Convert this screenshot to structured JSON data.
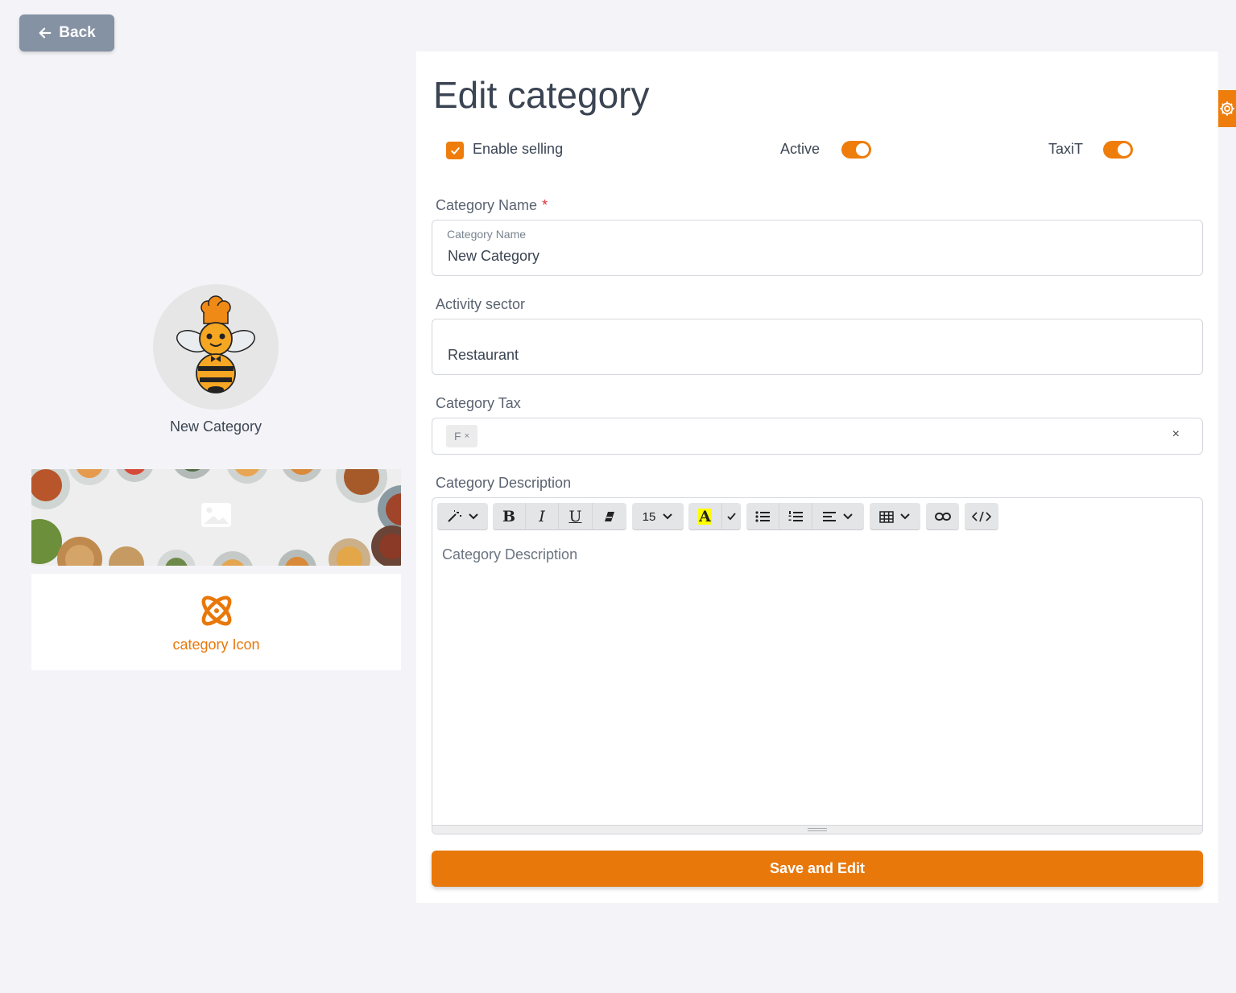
{
  "back": {
    "label": "Back",
    "icon": "arrow-left-icon"
  },
  "preview": {
    "name": "New Category",
    "icon_label": "category Icon",
    "icon": "atom-icon"
  },
  "form": {
    "title": "Edit category",
    "enable_selling": {
      "label": "Enable selling",
      "checked": true
    },
    "active": {
      "label": "Active",
      "on": true
    },
    "taxit": {
      "label": "TaxiT",
      "on": true
    },
    "category_name": {
      "label": "Category Name",
      "required_mark": "*",
      "floating_label": "Category Name",
      "value": "New Category"
    },
    "activity_sector": {
      "label": "Activity sector",
      "value": "Restaurant"
    },
    "category_tax": {
      "label": "Category Tax",
      "chip": "F",
      "chip_remove": "×",
      "clear": "×"
    },
    "category_description": {
      "label": "Category Description",
      "placeholder": "Category Description",
      "font_size": "15"
    },
    "save_label": "Save and Edit"
  },
  "colors": {
    "accent": "#e8780a",
    "back_button": "#8592a3",
    "background": "#f4f4f8"
  }
}
